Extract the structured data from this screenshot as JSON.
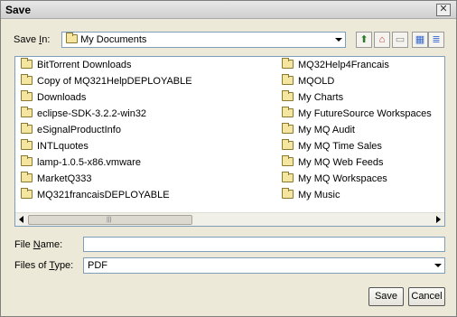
{
  "window": {
    "title": "Save",
    "close_glyph": "✕"
  },
  "save_in": {
    "label_prefix": "Save ",
    "label_mnemonic": "I",
    "label_suffix": "n:",
    "value": "My Documents"
  },
  "toolbar": [
    {
      "name": "up-one-level-icon",
      "glyph": "⬆"
    },
    {
      "name": "home-icon",
      "glyph": "⌂"
    },
    {
      "name": "new-folder-icon",
      "glyph": "▭"
    },
    {
      "name": "list-view-icon",
      "glyph": "▦"
    },
    {
      "name": "details-view-icon",
      "glyph": "≣"
    }
  ],
  "files_col1": [
    "BitTorrent Downloads",
    "Copy of MQ321HelpDEPLOYABLE",
    "Downloads",
    "eclipse-SDK-3.2.2-win32",
    "eSignalProductInfo",
    "INTLquotes",
    "lamp-1.0.5-x86.vmware",
    "MarketQ333",
    "MQ321francaisDEPLOYABLE"
  ],
  "files_col2": [
    "MQ32Help4Francais",
    "MQOLD",
    "My Charts",
    "My FutureSource Workspaces",
    "My MQ Audit",
    "My MQ Time Sales",
    "My MQ Web Feeds",
    "My MQ Workspaces",
    "My Music"
  ],
  "file_name": {
    "label_prefix": "File ",
    "label_mnemonic": "N",
    "label_suffix": "ame:",
    "value": ""
  },
  "file_type": {
    "label_prefix": "Files of ",
    "label_mnemonic": "T",
    "label_suffix": "ype:",
    "value": "PDF"
  },
  "buttons": {
    "save": "Save",
    "cancel": "Cancel"
  }
}
